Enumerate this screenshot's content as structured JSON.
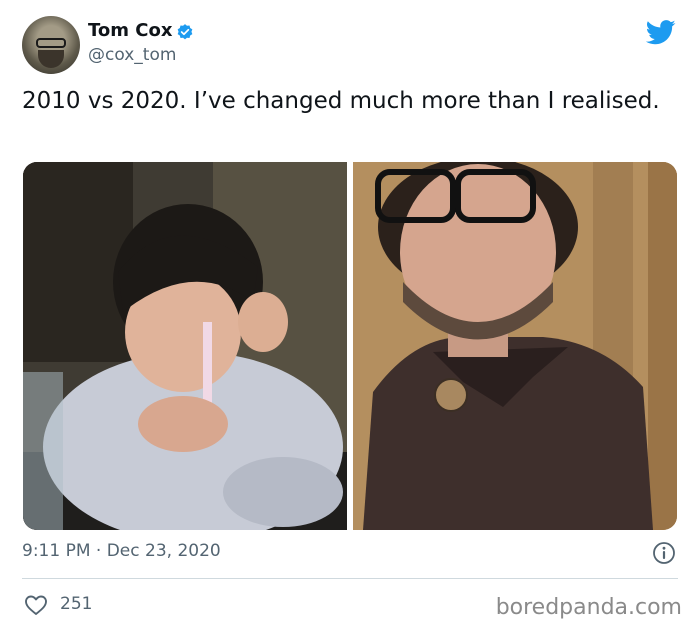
{
  "author": {
    "name": "Tom Cox",
    "handle": "@cox_tom"
  },
  "tweet": {
    "text": "2010 vs 2020. I’ve changed much more than I realised."
  },
  "meta": {
    "time": "9:11 PM",
    "separator": "·",
    "date": "Dec 23, 2020",
    "likes": "251"
  },
  "watermark": "boredpanda.com",
  "colors": {
    "twitter_blue": "#1d9bf0",
    "secondary_text": "#536471",
    "divider": "#cfd9de"
  },
  "icons": {
    "verified": "verified-badge-icon",
    "brand": "twitter-bird-icon",
    "info": "info-icon",
    "like": "heart-icon"
  }
}
